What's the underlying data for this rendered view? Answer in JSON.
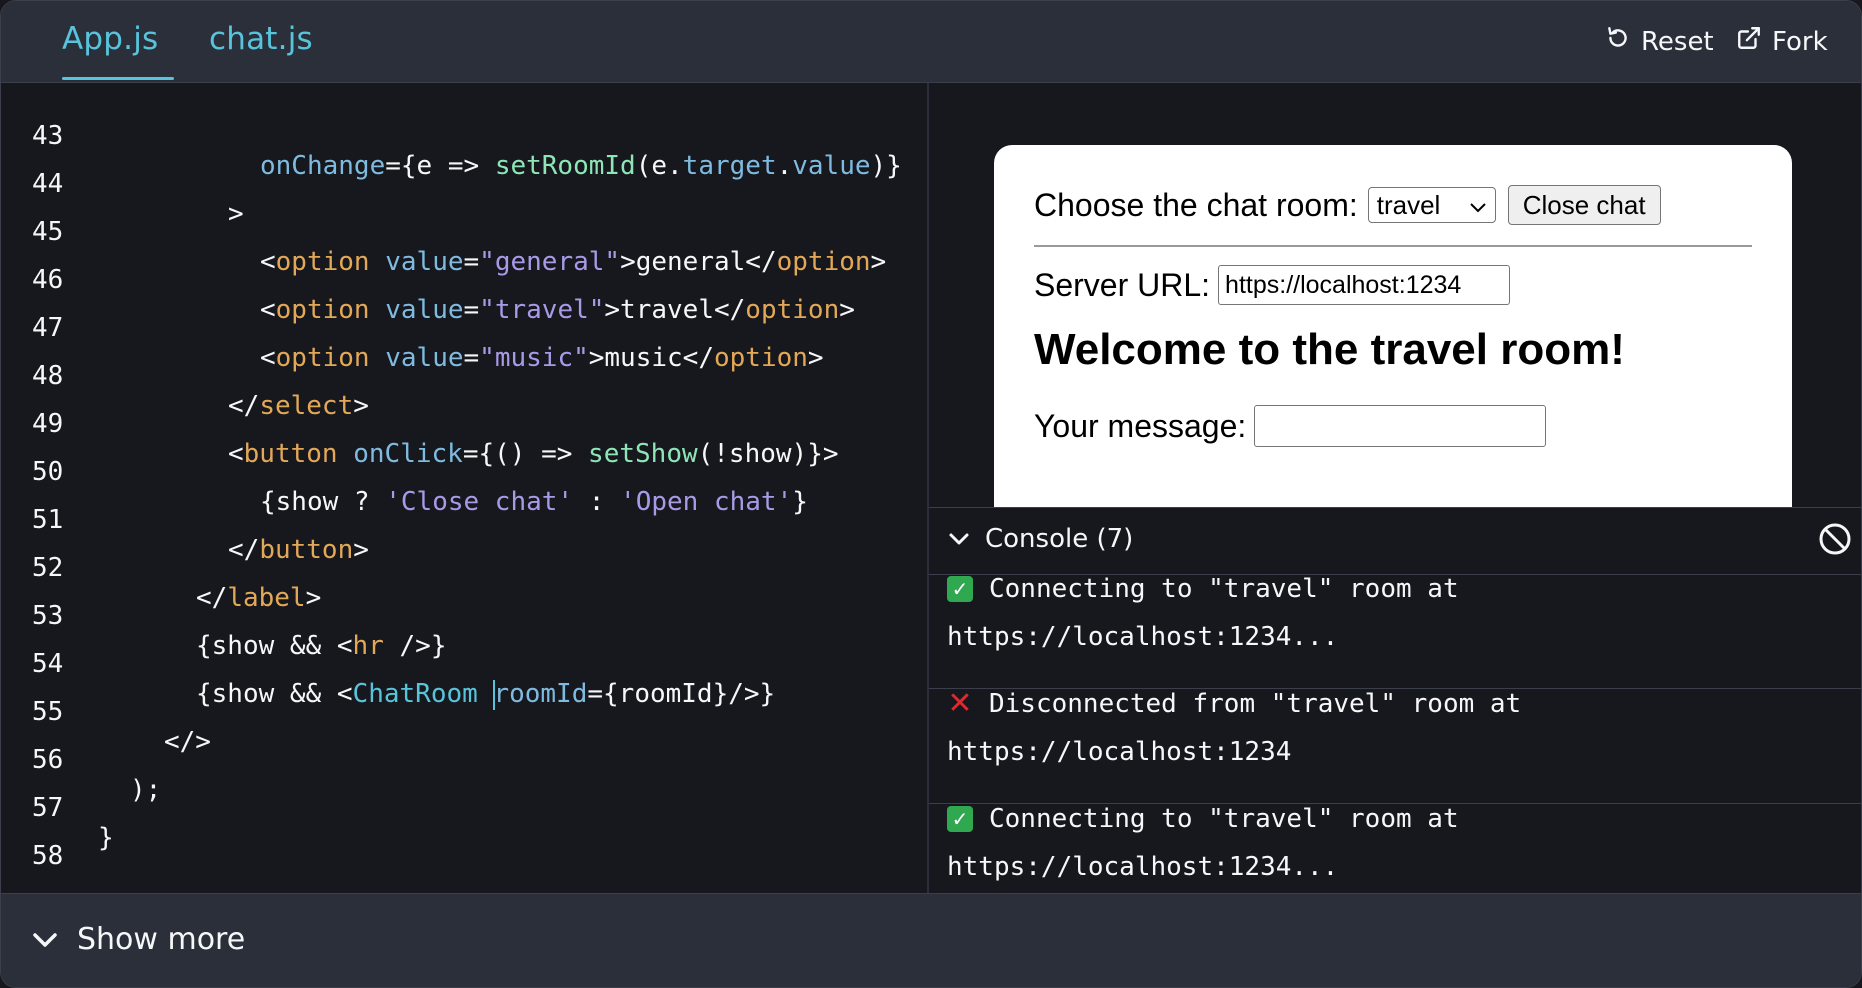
{
  "tabs": [
    {
      "label": "App.js",
      "active": true
    },
    {
      "label": "chat.js",
      "active": false
    }
  ],
  "toolbar": {
    "reset_label": "Reset",
    "fork_label": "Fork"
  },
  "code_lines": [
    {
      "n": "43"
    },
    {
      "n": "44"
    },
    {
      "n": "45"
    },
    {
      "n": "46"
    },
    {
      "n": "47"
    },
    {
      "n": "48"
    },
    {
      "n": "49"
    },
    {
      "n": "50"
    },
    {
      "n": "51"
    },
    {
      "n": "52"
    },
    {
      "n": "53"
    },
    {
      "n": "54"
    },
    {
      "n": "55"
    },
    {
      "n": "56"
    },
    {
      "n": "57"
    },
    {
      "n": "58"
    }
  ],
  "code": {
    "l43": {
      "attr": "onChange",
      "p1": "={e => ",
      "fn": "setRoomId",
      "p2": "(e.",
      "a2": "target",
      "p3": ".",
      "a3": "value",
      "p4": ")}"
    },
    "l44": {
      "p1": ">"
    },
    "l45": {
      "lt": "<",
      "tag": "option",
      "sp": " ",
      "attr": "value",
      "eq": "=",
      "str": "\"general\"",
      "text": ">general</",
      "tag2": "option",
      "gt": ">"
    },
    "l46": {
      "lt": "<",
      "tag": "option",
      "sp": " ",
      "attr": "value",
      "eq": "=",
      "str": "\"travel\"",
      "text": ">travel</",
      "tag2": "option",
      "gt": ">"
    },
    "l47": {
      "lt": "<",
      "tag": "option",
      "sp": " ",
      "attr": "value",
      "eq": "=",
      "str": "\"music\"",
      "text": ">music</",
      "tag2": "option",
      "gt": ">"
    },
    "l48": {
      "lt": "</",
      "tag": "select",
      "gt": ">"
    },
    "l49": {
      "lt": "<",
      "tag": "button",
      "sp": " ",
      "attr": "onClick",
      "p1": "={() => ",
      "fn": "setShow",
      "p2": "(!show)}>"
    },
    "l50": {
      "p1": "{show ? ",
      "s1": "'Close chat'",
      "p2": " : ",
      "s2": "'Open chat'",
      "p3": "}"
    },
    "l51": {
      "lt": "</",
      "tag": "button",
      "gt": ">"
    },
    "l52": {
      "lt": "</",
      "tag": "label",
      "gt": ">"
    },
    "l53": {
      "p1": "{show && <",
      "tag": "hr",
      "p2": " />}"
    },
    "l54": {
      "p1": "{show && <",
      "comp": "ChatRoom",
      "sp": " ",
      "attr": "roomId",
      "p2": "={roomId}/>}"
    },
    "l55": {
      "p1": "</>"
    },
    "l56": {
      "p1": ");"
    },
    "l57": {
      "p1": "}"
    },
    "l58": {
      "p1": ""
    }
  },
  "preview": {
    "choose_label": "Choose the chat room:",
    "select_value": "travel",
    "close_button": "Close chat",
    "server_label": "Server URL:",
    "server_value": "https://localhost:1234",
    "welcome": "Welcome to the travel room!",
    "message_label": "Your message:",
    "message_value": ""
  },
  "console": {
    "title": "Console (7)",
    "logs": [
      {
        "icon": "check-icon",
        "line1": "Connecting to \"travel\" room at",
        "line2": "https://localhost:1234..."
      },
      {
        "icon": "cross-icon",
        "line1": "Disconnected from \"travel\" room at",
        "line2": "https://localhost:1234"
      },
      {
        "icon": "check-icon",
        "line1": "Connecting to \"travel\" room at",
        "line2": "https://localhost:1234..."
      }
    ]
  },
  "footer": {
    "show_more": "Show more"
  },
  "colors": {
    "accent": "#58c4dc",
    "background": "#16181d",
    "panel": "#2a2f3a",
    "attr": "#7fbbe0",
    "function": "#8ee6b6",
    "tag": "#e3a857",
    "string": "#a99ae8"
  }
}
